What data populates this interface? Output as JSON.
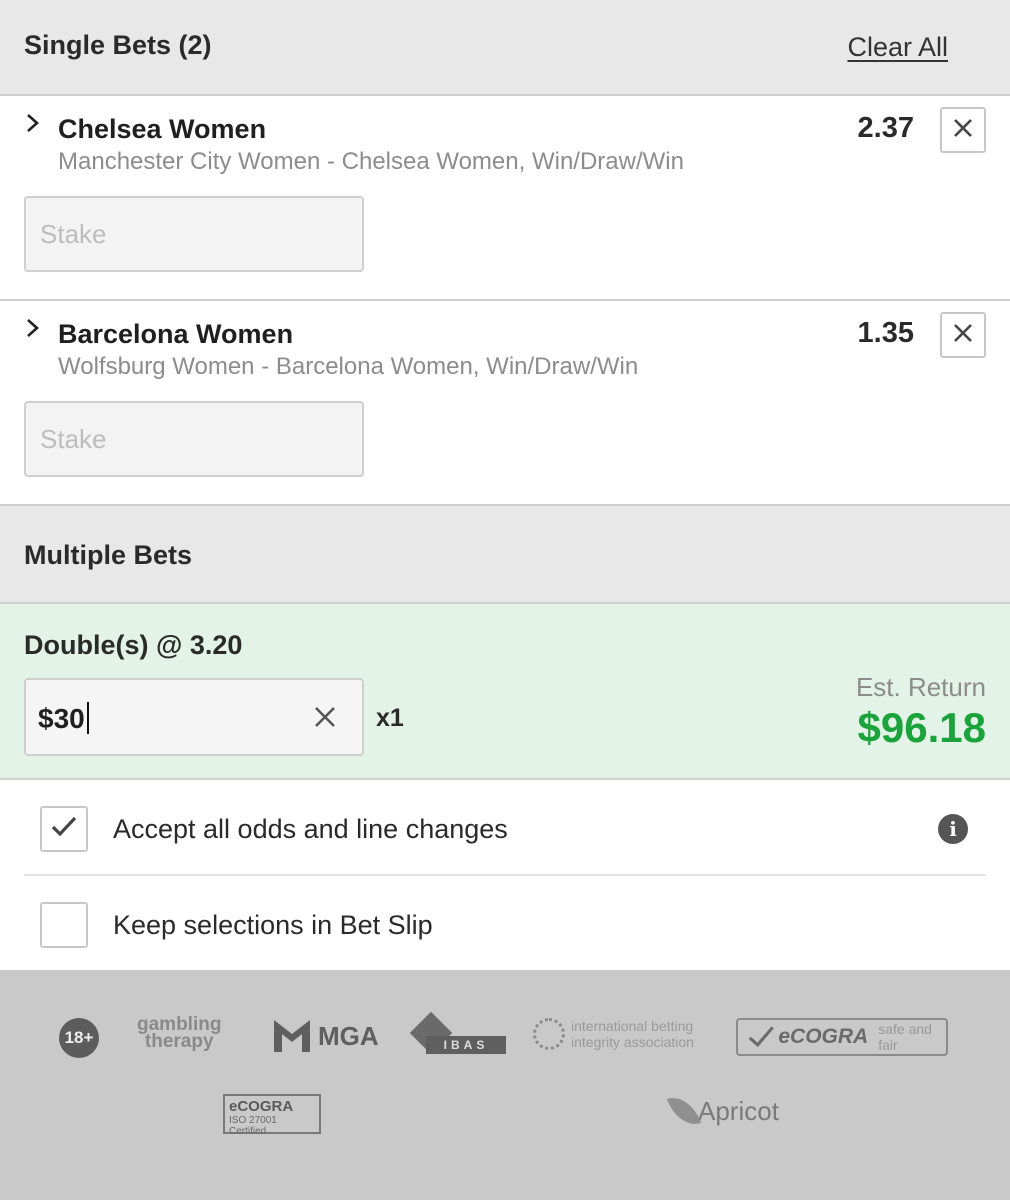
{
  "single_bets": {
    "title": "Single Bets (2)",
    "clear_all": "Clear All",
    "bets": [
      {
        "team": "Chelsea Women",
        "market": "Manchester City Women - Chelsea Women, Win/Draw/Win",
        "odds": "2.37",
        "stake_placeholder": "Stake"
      },
      {
        "team": "Barcelona Women",
        "market": "Wolfsburg Women - Barcelona Women, Win/Draw/Win",
        "odds": "1.35",
        "stake_placeholder": "Stake"
      }
    ]
  },
  "multiple_bets": {
    "title": "Multiple Bets",
    "double": {
      "label": "Double(s) @ 3.20",
      "stake_value": "$30",
      "multiplier": "x1",
      "est_return_label": "Est. Return",
      "est_return_value": "$96.18"
    }
  },
  "options": [
    {
      "label": "Accept all odds and line changes",
      "checked": true
    },
    {
      "label": "Keep selections in Bet Slip",
      "checked": false
    }
  ],
  "footer": {
    "logos": {
      "age": "18+",
      "gambling_therapy_1": "gambling",
      "gambling_therapy_2": "therapy",
      "mga": "MGA",
      "ibas": "IBAS",
      "ibia_1": "international betting",
      "ibia_2": "integrity association",
      "ecogra": "eCOGRA",
      "ecogra_tag": "safe and fair",
      "ecogra_iso_1": "eCOGRA",
      "ecogra_iso_2": "ISO 27001 Certified",
      "apricot": "Apricot"
    }
  },
  "colors": {
    "accent_green": "#1aa33b",
    "double_bg": "#e3f3e7",
    "header_bg": "#e8e8e8",
    "footer_bg": "#c9c9c9"
  }
}
